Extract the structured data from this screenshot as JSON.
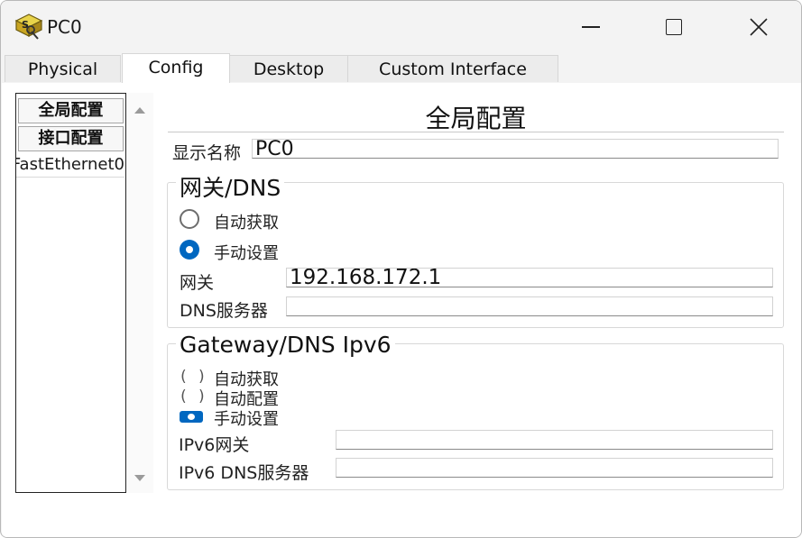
{
  "window": {
    "title": "PC0",
    "icon": "packet-tracer-pc-icon"
  },
  "tabs": [
    {
      "label": "Physical",
      "active": false
    },
    {
      "label": "Config",
      "active": true
    },
    {
      "label": "Desktop",
      "active": false
    },
    {
      "label": "Custom Interface",
      "active": false
    }
  ],
  "sidebar": {
    "global_button": "全局配置",
    "interface_button": "接口配置",
    "items": [
      "FastEthernet0"
    ]
  },
  "panel": {
    "heading": "全局配置",
    "display_name_label": "显示名称",
    "display_name_value": "PC0",
    "gateway_dns": {
      "legend": "网关/DNS",
      "auto_label": "自动获取",
      "manual_label": "手动设置",
      "selected": "manual",
      "gateway_label": "网关",
      "gateway_value": "192.168.172.1",
      "dns_label": "DNS服务器",
      "dns_value": ""
    },
    "gateway_dns_v6": {
      "legend": "Gateway/DNS Ipv6",
      "auto_label": "自动获取",
      "autoconfig_label": "自动配置",
      "manual_label": "手动设置",
      "selected": "manual",
      "gateway_label": "IPv6网关",
      "gateway_value": "",
      "dns_label": "IPv6 DNS服务器",
      "dns_value": ""
    }
  },
  "colors": {
    "accent": "#0067c0",
    "window_bg": "#f3f3f3"
  }
}
